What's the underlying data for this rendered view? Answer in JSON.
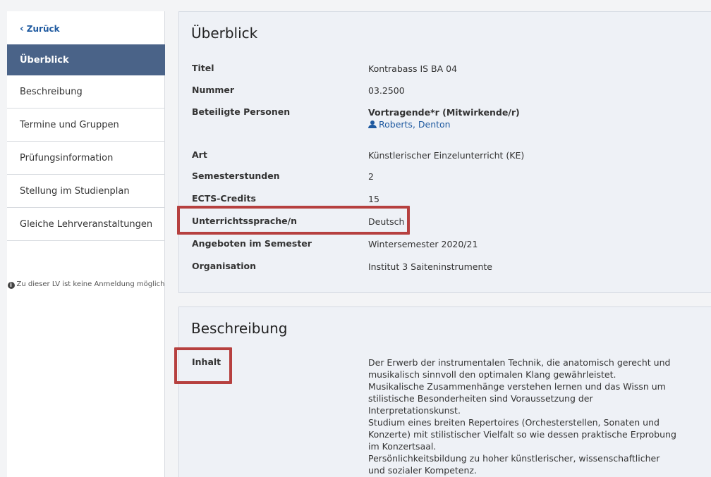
{
  "sidebar": {
    "back_label": "Zurück",
    "items": [
      {
        "label": "Überblick",
        "active": true
      },
      {
        "label": "Beschreibung"
      },
      {
        "label": "Termine und Gruppen"
      },
      {
        "label": "Prüfungsinformation"
      },
      {
        "label": "Stellung im Studienplan"
      },
      {
        "label": "Gleiche Lehrveranstaltungen"
      }
    ],
    "notice": "Zu dieser LV ist keine Anmeldung möglich"
  },
  "overview": {
    "title": "Überblick",
    "rows": {
      "titel": {
        "label": "Titel",
        "value": "Kontrabass IS BA 04"
      },
      "nummer": {
        "label": "Nummer",
        "value": "03.2500"
      },
      "personen": {
        "label": "Beteiligte Personen",
        "role": "Vortragende*r (Mitwirkende/r)",
        "person": "Roberts, Denton"
      },
      "art": {
        "label": "Art",
        "value": "Künstlerischer Einzelunterricht (KE)"
      },
      "semesterstunden": {
        "label": "Semesterstunden",
        "value": "2"
      },
      "ects": {
        "label": "ECTS-Credits",
        "value": "15"
      },
      "sprache": {
        "label": "Unterrichtssprache/n",
        "value": "Deutsch"
      },
      "semester": {
        "label": "Angeboten im Semester",
        "value": "Wintersemester 2020/21"
      },
      "organisation": {
        "label": "Organisation",
        "value": "Institut 3 Saiteninstrumente"
      }
    }
  },
  "description": {
    "title": "Beschreibung",
    "inhalt_label": "Inhalt",
    "inhalt_lines": [
      "Der Erwerb der instrumentalen Technik, die anatomisch gerecht und",
      "musikalisch sinnvoll den optimalen Klang gewährleistet.",
      "Musikalische Zusammenhänge verstehen lernen und das Wissn um",
      "stilistische Besonderheiten sind Voraussetzung der",
      "Interpretationskunst.",
      "Studium eines breiten Repertoires (Orchesterstellen, Sonaten und",
      "Konzerte) mit stilistischer Vielfalt so wie dessen praktische Erprobung",
      "im Konzertsaal.",
      "Persönlichkeitsbildung zu hoher künstlerischer, wissenschaftlicher",
      "und sozialer Kompetenz."
    ]
  },
  "colors": {
    "accent": "#4a6388",
    "link": "#1f5aa0",
    "highlight": "#b6403f"
  }
}
